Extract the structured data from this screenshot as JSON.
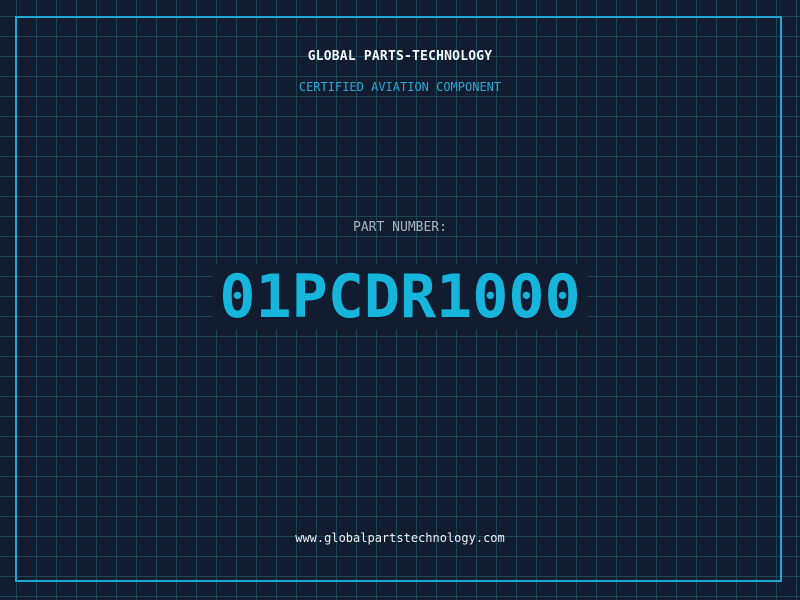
{
  "header": {
    "company": "GLOBAL PARTS-TECHNOLOGY",
    "subtitle": "CERTIFIED AVIATION COMPONENT"
  },
  "part": {
    "label": "PART NUMBER:",
    "number": "01PCDR1000"
  },
  "footer": {
    "website": "www.globalpartstechnology.com"
  },
  "colors": {
    "background": "#111c30",
    "grid": "#1c4656",
    "border": "#1fa8d4",
    "accent": "#16b6dc",
    "label": "#a6b4c6",
    "text": "#f2f6fa"
  }
}
